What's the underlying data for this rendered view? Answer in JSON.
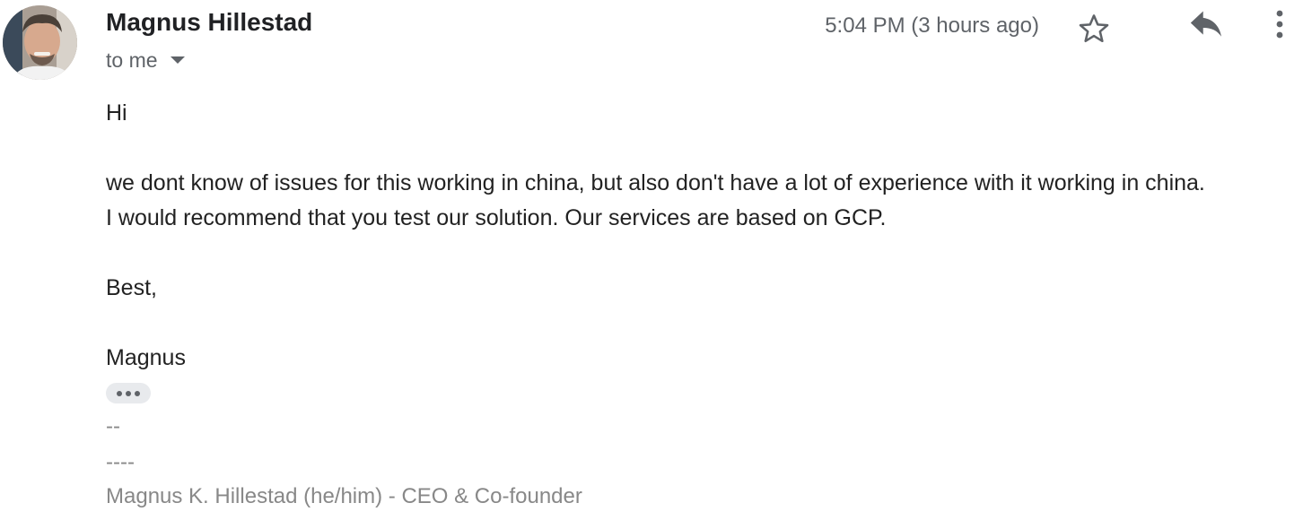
{
  "sender": {
    "name": "Magnus Hillestad",
    "recipient_label": "to me"
  },
  "meta": {
    "timestamp": "5:04 PM (3 hours ago)"
  },
  "icons": {
    "avatar": "sender-avatar",
    "star": "star-icon",
    "reply": "reply-icon",
    "more": "more-vertical-icon",
    "caret": "chevron-down-icon",
    "trimmed": "ellipsis-icon"
  },
  "body": {
    "greeting": "Hi",
    "line1": "we dont know of issues for this working in china, but also don't have a lot of experience with it working in china.",
    "line2": "I would recommend that you test our solution. Our services are based on GCP.",
    "closing": "Best,",
    "signoff": "Magnus"
  },
  "signature": {
    "sep1": "--",
    "sep2": "----",
    "title_line": "Magnus K. Hillestad (he/him) - CEO & Co-founder"
  },
  "colors": {
    "text": "#222222",
    "secondary": "#5f6368",
    "signature": "#888888"
  }
}
